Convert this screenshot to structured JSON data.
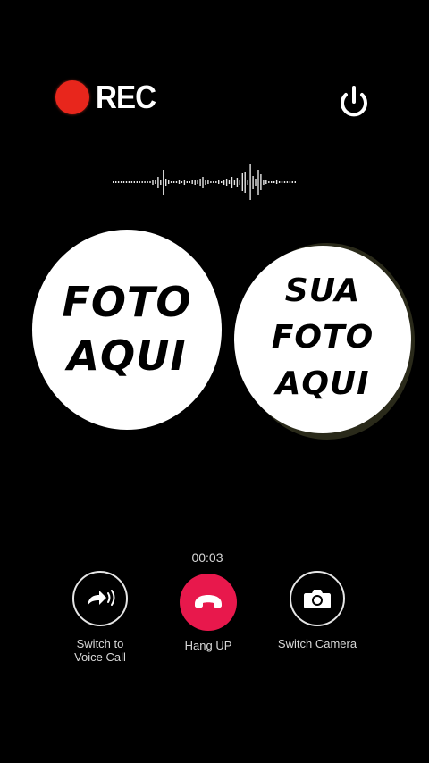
{
  "header": {
    "rec_label": "REC",
    "rec_color": "#e8261c"
  },
  "icons": {
    "power": "power-icon",
    "forward": "voice-call-icon",
    "phone": "phone-hangup-icon",
    "camera": "camera-icon"
  },
  "photos": {
    "left": {
      "line1": "FOTO",
      "line2": "AQUI"
    },
    "right": {
      "line1": "SUA",
      "line2": "FOTO",
      "line3": "AQUI"
    }
  },
  "call": {
    "timer": "00:03",
    "switch_voice_line1": "Switch to",
    "switch_voice_line2": "Voice Call",
    "hang_up": "Hang UP",
    "switch_camera": "Switch Camera",
    "hangup_color": "#e8184c"
  }
}
